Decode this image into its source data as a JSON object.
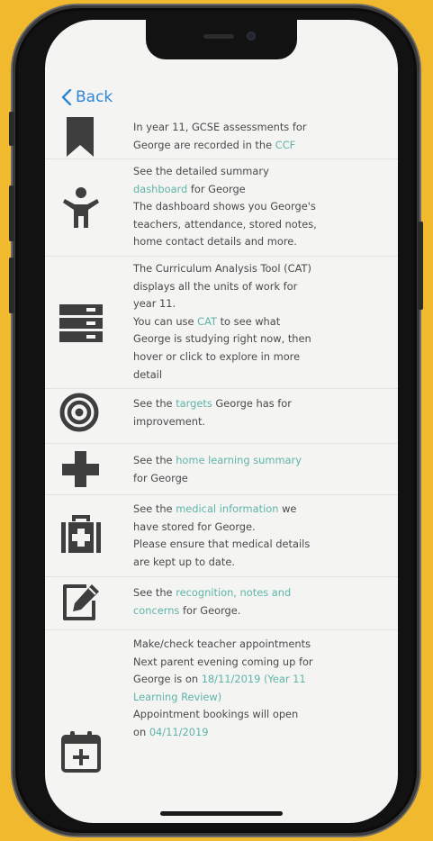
{
  "nav": {
    "back_label": "Back"
  },
  "items": [
    {
      "icon": "bookmark-icon",
      "line1": "In year 11, GCSE assessments for",
      "line2": "George are recorded in the ",
      "link": "CCF"
    },
    {
      "icon": "person-icon",
      "line1": "See the detailed summary",
      "link": "dashboard",
      "line2_after": " for George",
      "line3": "The dashboard shows you George's",
      "line4": "teachers, attendance, stored notes,",
      "line5": "home contact details and more."
    },
    {
      "icon": "server-stack-icon",
      "line1": "The Curriculum Analysis Tool (CAT)",
      "line2": "displays all the units of work for",
      "line3": "year 11.",
      "line4_pre": "You can use ",
      "link": "CAT",
      "line4_post": " to see what",
      "line5": "George is studying right now, then",
      "line6": "hover or click to explore in more",
      "line7": "detail"
    },
    {
      "icon": "target-icon",
      "line1_pre": "See the ",
      "link": "targets",
      "line1_post": " George has for",
      "line2": "improvement."
    },
    {
      "icon": "plus-icon",
      "line1_pre": "See the ",
      "link": "home learning summary",
      "line2": "for George"
    },
    {
      "icon": "medical-kit-icon",
      "line1_pre": "See the ",
      "link": "medical information",
      "line1_post": " we",
      "line2": "have stored for George.",
      "line3": "Please ensure that medical details",
      "line4": "are kept up to date."
    },
    {
      "icon": "edit-note-icon",
      "line1_pre": "See the ",
      "link1": "recognition, notes and",
      "link2": "concerns",
      "line2_post": " for George."
    },
    {
      "icon": "calendar-add-icon",
      "line1": "Make/check teacher appointments",
      "line2": "Next parent evening coming up for",
      "line3_pre": "George is on ",
      "link1": "18/11/2019 (Year 11",
      "link2": "Learning Review)",
      "line5": "Appointment bookings will open",
      "line6_pre": "on ",
      "link3": "04/11/2019"
    }
  ]
}
